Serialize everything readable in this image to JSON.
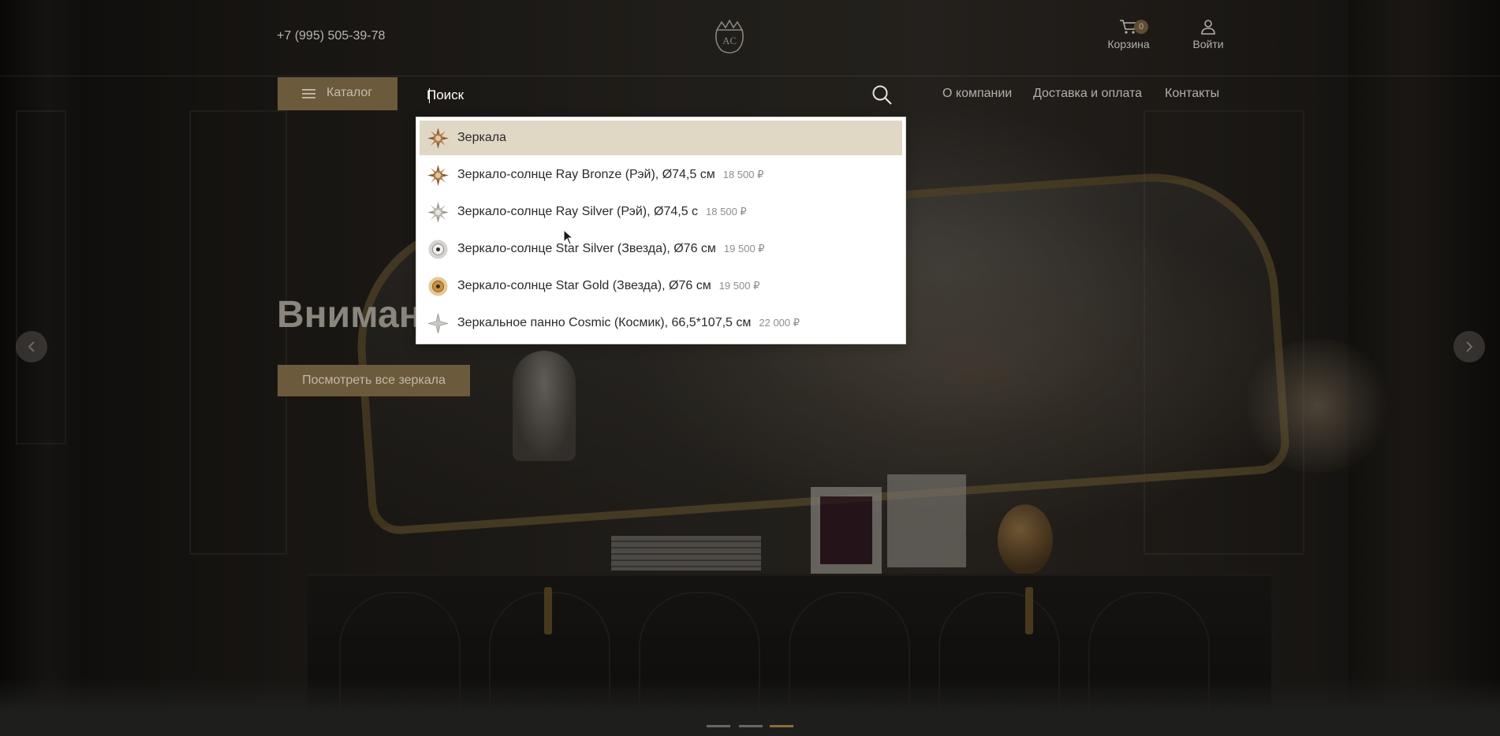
{
  "header": {
    "phone": "+7 (995) 505-39-78",
    "logo_icon": "crown-monogram-logo",
    "cart": {
      "label": "Корзина",
      "count": "0",
      "icon": "cart-icon"
    },
    "login": {
      "label": "Войти",
      "icon": "user-icon"
    }
  },
  "navbar": {
    "catalog_label": "Каталог",
    "search": {
      "value": "",
      "placeholder": "Поиск",
      "icon": "search-icon"
    },
    "links": [
      "О компании",
      "Доставка и оплата",
      "Контакты"
    ]
  },
  "search_suggestions": [
    {
      "name": "Зеркала",
      "price": "",
      "thumb": "sun-mirror-bronze",
      "highlighted": true
    },
    {
      "name": "Зеркало-солнце Ray Bronze (Рэй), Ø74,5 см",
      "price": "18 500 ₽",
      "thumb": "sun-mirror-bronze"
    },
    {
      "name": "Зеркало-солнце Ray Silver (Рэй), Ø74,5 с",
      "price": "18 500 ₽",
      "thumb": "sun-mirror-silver"
    },
    {
      "name": "Зеркало-солнце Star Silver (Звезда), Ø76 см",
      "price": "19 500 ₽",
      "thumb": "star-mirror-silver"
    },
    {
      "name": "Зеркало-солнце Star Gold (Звезда), Ø76 см",
      "price": "19 500 ₽",
      "thumb": "star-mirror-gold"
    },
    {
      "name": "Зеркальное панно Cosmic (Космик), 66,5*107,5 см",
      "price": "22 000 ₽",
      "thumb": "cosmic-panel"
    }
  ],
  "hero": {
    "title": "Вниман",
    "button_label": "Посмотреть все зеркала",
    "slides_total": 3,
    "active_slide": 3
  },
  "colors": {
    "accent": "#6b5a3c",
    "dropdown_highlight": "#e0d7c4",
    "active_dot": "#8a6d37"
  }
}
